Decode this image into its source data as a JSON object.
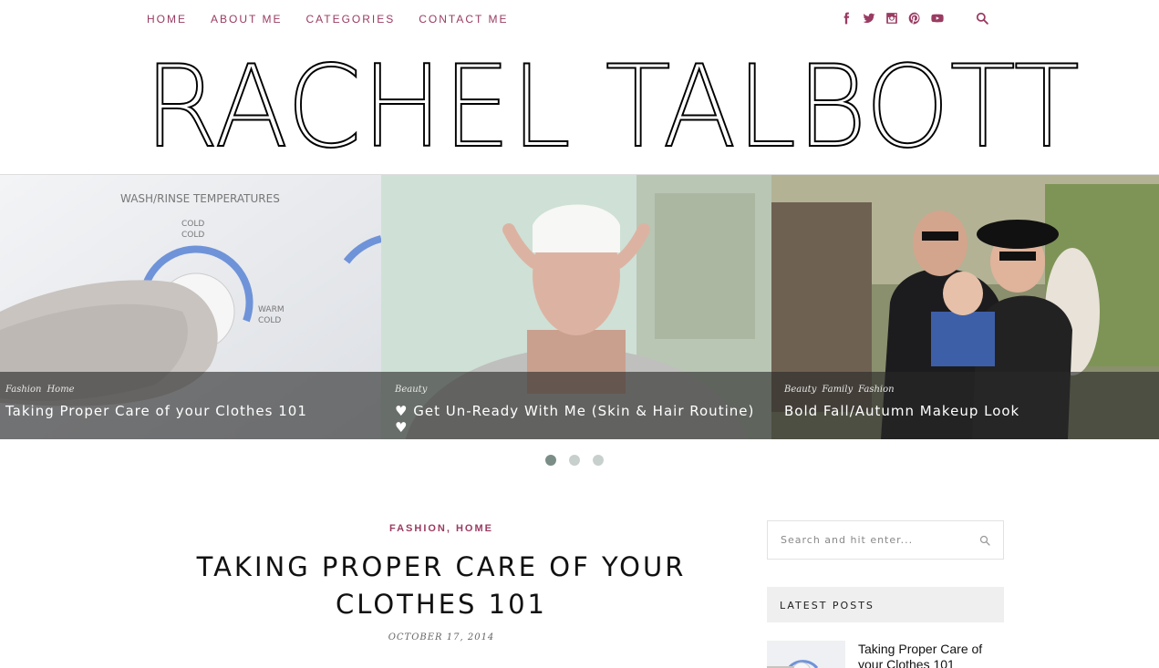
{
  "nav": {
    "links": [
      "HOME",
      "ABOUT ME",
      "CATEGORIES",
      "CONTACT ME"
    ],
    "socials": [
      "facebook-icon",
      "twitter-icon",
      "instagram-icon",
      "pinterest-icon",
      "youtube-icon"
    ],
    "accent_color": "#9a3b62"
  },
  "logo": {
    "text": "RACHEL TALBOTT"
  },
  "slider": {
    "slides": [
      {
        "categories": [
          "Fashion",
          "Home"
        ],
        "title": "Taking Proper Care of your Clothes 101"
      },
      {
        "categories": [
          "Beauty"
        ],
        "title": "♥ Get Un-Ready With Me (Skin & Hair Routine) ♥"
      },
      {
        "categories": [
          "Beauty",
          "Family",
          "Fashion"
        ],
        "title": "Bold Fall/Autumn Makeup Look"
      }
    ],
    "active_dot": 0,
    "dot_count": 3
  },
  "post": {
    "categories": "FASHION, HOME",
    "title": "TAKING PROPER CARE OF YOUR CLOTHES 101",
    "date": "OCTOBER 17, 2014"
  },
  "sidebar": {
    "search_placeholder": "Search and hit enter...",
    "latest_header": "LATEST POSTS",
    "latest_posts": [
      {
        "title": "Taking Proper Care of your Clothes 101"
      }
    ]
  }
}
